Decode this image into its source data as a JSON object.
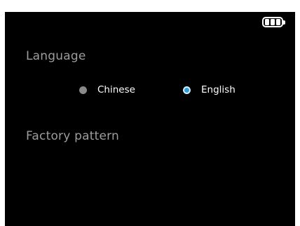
{
  "status": {
    "battery_icon": "battery-full-icon"
  },
  "language": {
    "title": "Language",
    "options": [
      {
        "label": "Chinese",
        "selected": false
      },
      {
        "label": "English",
        "selected": true
      }
    ],
    "accent_color": "#2f9be0"
  },
  "factory": {
    "title": "Factory pattern"
  }
}
